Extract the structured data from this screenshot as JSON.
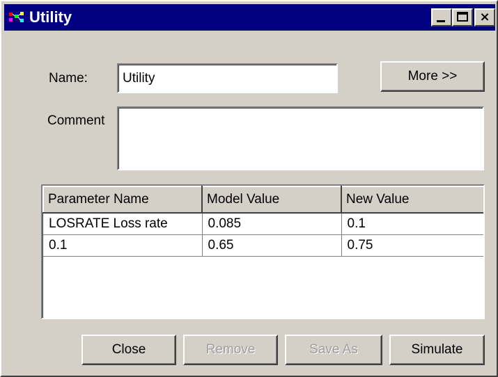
{
  "window": {
    "title": "Utility",
    "minimize_label": "_",
    "close_label": "×"
  },
  "form": {
    "name_label": "Name:",
    "name_value": "Utility",
    "comment_label": "Comment",
    "comment_value": "",
    "more_label": "More >>"
  },
  "grid": {
    "columns": [
      "Parameter Name",
      "Model Value",
      "New Value"
    ],
    "rows": [
      [
        "LOSRATE Loss rate",
        "0.085",
        "0.1"
      ],
      [
        "0.1",
        "0.65",
        "0.75"
      ]
    ]
  },
  "buttons": {
    "close": "Close",
    "remove": "Remove",
    "save_as": "Save As",
    "simulate": "Simulate"
  },
  "icons": {
    "app": "app-icon",
    "minimize": "minimize-icon",
    "maximize": "maximize-icon",
    "close": "close-icon"
  },
  "colors": {
    "titlebar": "#000080",
    "face": "#d4d0c8",
    "disabled_text": "#a0a0a0"
  }
}
